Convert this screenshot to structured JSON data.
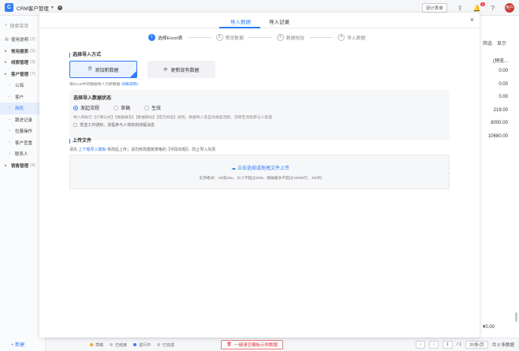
{
  "app": {
    "title": "CRM客户管理",
    "logo": "C",
    "design_button": "设计表单",
    "avatar": "用户",
    "badge_count": "9"
  },
  "sidebar": {
    "search_placeholder": "搜索菜单",
    "items": [
      {
        "label": "使用说明",
        "badge": "(2)",
        "type": "item"
      },
      {
        "label": "常用报表",
        "badge": "(3)",
        "type": "grp"
      },
      {
        "label": "线索管理",
        "badge": "(3)",
        "type": "grp"
      },
      {
        "label": "客户管理",
        "badge": "(7)",
        "type": "grp"
      },
      {
        "label": "公海",
        "badge": "",
        "type": "sub"
      },
      {
        "label": "客户",
        "badge": "",
        "type": "sub"
      },
      {
        "label": "商机",
        "badge": "",
        "type": "sub-active"
      },
      {
        "label": "跟进记录",
        "badge": "",
        "type": "sub"
      },
      {
        "label": "拉量操作",
        "badge": "",
        "type": "sub"
      },
      {
        "label": "客户查重",
        "badge": "",
        "type": "sub"
      },
      {
        "label": "联系人",
        "badge": "",
        "type": "sub"
      },
      {
        "label": "销售管理",
        "badge": "(4)",
        "type": "grp"
      }
    ],
    "new_button": "+ 新建"
  },
  "background_table": {
    "tools": [
      "筛选",
      "显示"
    ],
    "col_header": "(预览...",
    "values": [
      "0.00",
      "0.00",
      "0.00",
      "219.00",
      "8000.00",
      "10680.00"
    ],
    "col2": [
      "预",
      "预",
      "预"
    ],
    "dropdown": "¥0.00"
  },
  "footer": {
    "legend": [
      {
        "label": "草稿",
        "color": "#f2a23c"
      },
      {
        "label": "已结束",
        "color": "#bfc3ca"
      },
      {
        "label": "进行中",
        "color": "#2f7cf6"
      },
      {
        "label": "已完成",
        "color": "#bfc3ca"
      }
    ],
    "clear_button": "一键清空模板示例数据",
    "page_current": "1",
    "page_total": "/ 1",
    "page_size": "20条/页",
    "total": "共 6 条数据"
  },
  "modal": {
    "tabs": [
      "导入数据",
      "导入记录"
    ],
    "active_tab": 0,
    "steps": [
      {
        "num": "1",
        "label": "选择Excel表"
      },
      {
        "num": "2",
        "label": "预览数据"
      },
      {
        "num": "3",
        "label": "数据校验"
      },
      {
        "num": "4",
        "label": "导入数据"
      }
    ],
    "import_mode": {
      "title": "选择导入方式",
      "option_add": "添加新数据",
      "option_update": "更新现有数据",
      "desc": "将Excel中的数据导入为新数据",
      "desc_link": "详细说明>"
    },
    "status": {
      "title": "选择导入数据状态",
      "options": [
        "发起流程",
        "草稿",
        "生效"
      ],
      "selected": 0,
      "note": "导入将执行【计算公式】【数据填充】【数据联动】【提交校验】规则，数据导入后自动发起流程，流转至流程参与人处理",
      "checkbox": "发送工作通知，流程参与人将收到流程消息"
    },
    "upload": {
      "title": "上传文件",
      "desc_prefix": "请先",
      "desc_link": "上下载导入模板",
      "desc_suffix": "将改后上传；请勿修改模板表格的【字段标题】，防止导入失败",
      "dropzone_main": "点击选择或拖拽文件上传",
      "dropzone_sub": "支持格式：xls或xlsx，大小不超过20M，数据最多不超过10000行，200列"
    }
  }
}
